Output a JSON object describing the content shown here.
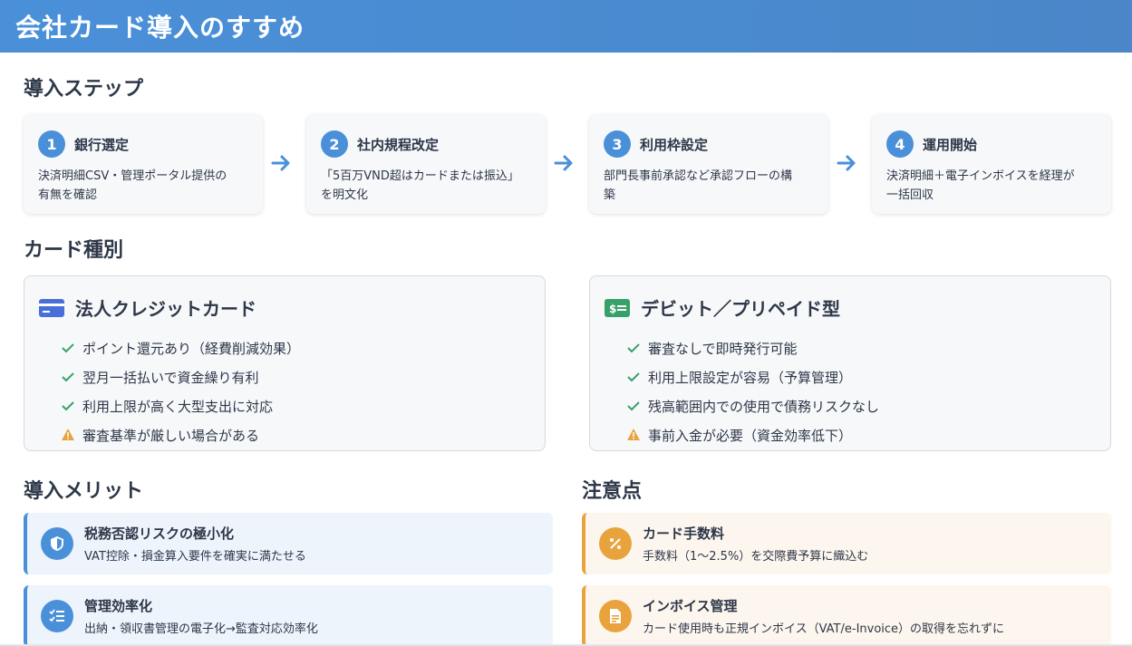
{
  "header": {
    "title": "会社カード導入のすすめ"
  },
  "sections": {
    "steps_title": "導入ステップ",
    "types_title": "カード種別",
    "merits_title": "導入メリット",
    "cautions_title": "注意点"
  },
  "steps": [
    {
      "num": "1",
      "title": "銀行選定",
      "line1": "決済明細CSV・管理ポータル提供の",
      "line2": "有無を確認"
    },
    {
      "num": "2",
      "title": "社内規程改定",
      "line1": "「5百万VND超はカードまたは振込」",
      "line2": "を明文化"
    },
    {
      "num": "3",
      "title": "利用枠設定",
      "line1": "部門長事前承認など承認フローの構",
      "line2": "築"
    },
    {
      "num": "4",
      "title": "運用開始",
      "line1": "決済明細＋電子インボイスを経理が",
      "line2": "一括回収"
    }
  ],
  "card_types": [
    {
      "title": "法人クレジットカード",
      "icon": "credit-card-icon",
      "items": [
        {
          "mark": "check",
          "text": "ポイント還元あり（経費削減効果）"
        },
        {
          "mark": "check",
          "text": "翌月一括払いで資金繰り有利"
        },
        {
          "mark": "check",
          "text": "利用上限が高く大型支出に対応"
        },
        {
          "mark": "warning",
          "text": "審査基準が厳しい場合がある"
        }
      ]
    },
    {
      "title": "デビット／プリペイド型",
      "icon": "money-bill-icon",
      "items": [
        {
          "mark": "check",
          "text": "審査なしで即時発行可能"
        },
        {
          "mark": "check",
          "text": "利用上限設定が容易（予算管理）"
        },
        {
          "mark": "check",
          "text": "残高範囲内での使用で債務リスクなし"
        },
        {
          "mark": "warning",
          "text": "事前入金が必要（資金効率低下）"
        }
      ]
    }
  ],
  "merits": [
    {
      "title": "税務否認リスクの極小化",
      "desc": "VAT控除・損金算入要件を確実に満たせる",
      "icon": "shield-icon"
    },
    {
      "title": "管理効率化",
      "desc": "出納・領収書管理の電子化→監査対応効率化",
      "icon": "checklist-icon"
    }
  ],
  "cautions": [
    {
      "title": "カード手数料",
      "desc": "手数料（1〜2.5%）を交際費予算に織込む",
      "icon": "percent-icon"
    },
    {
      "title": "インボイス管理",
      "desc": "カード使用時も正規インボイス（VAT/e-Invoice）の取得を忘れずに",
      "icon": "document-icon"
    }
  ],
  "colors": {
    "accent": "#4a90d9",
    "check": "#38a169",
    "warning": "#e8a33d",
    "caution_bg": "#fdf6ee",
    "merit_bg": "#edf4fc"
  }
}
